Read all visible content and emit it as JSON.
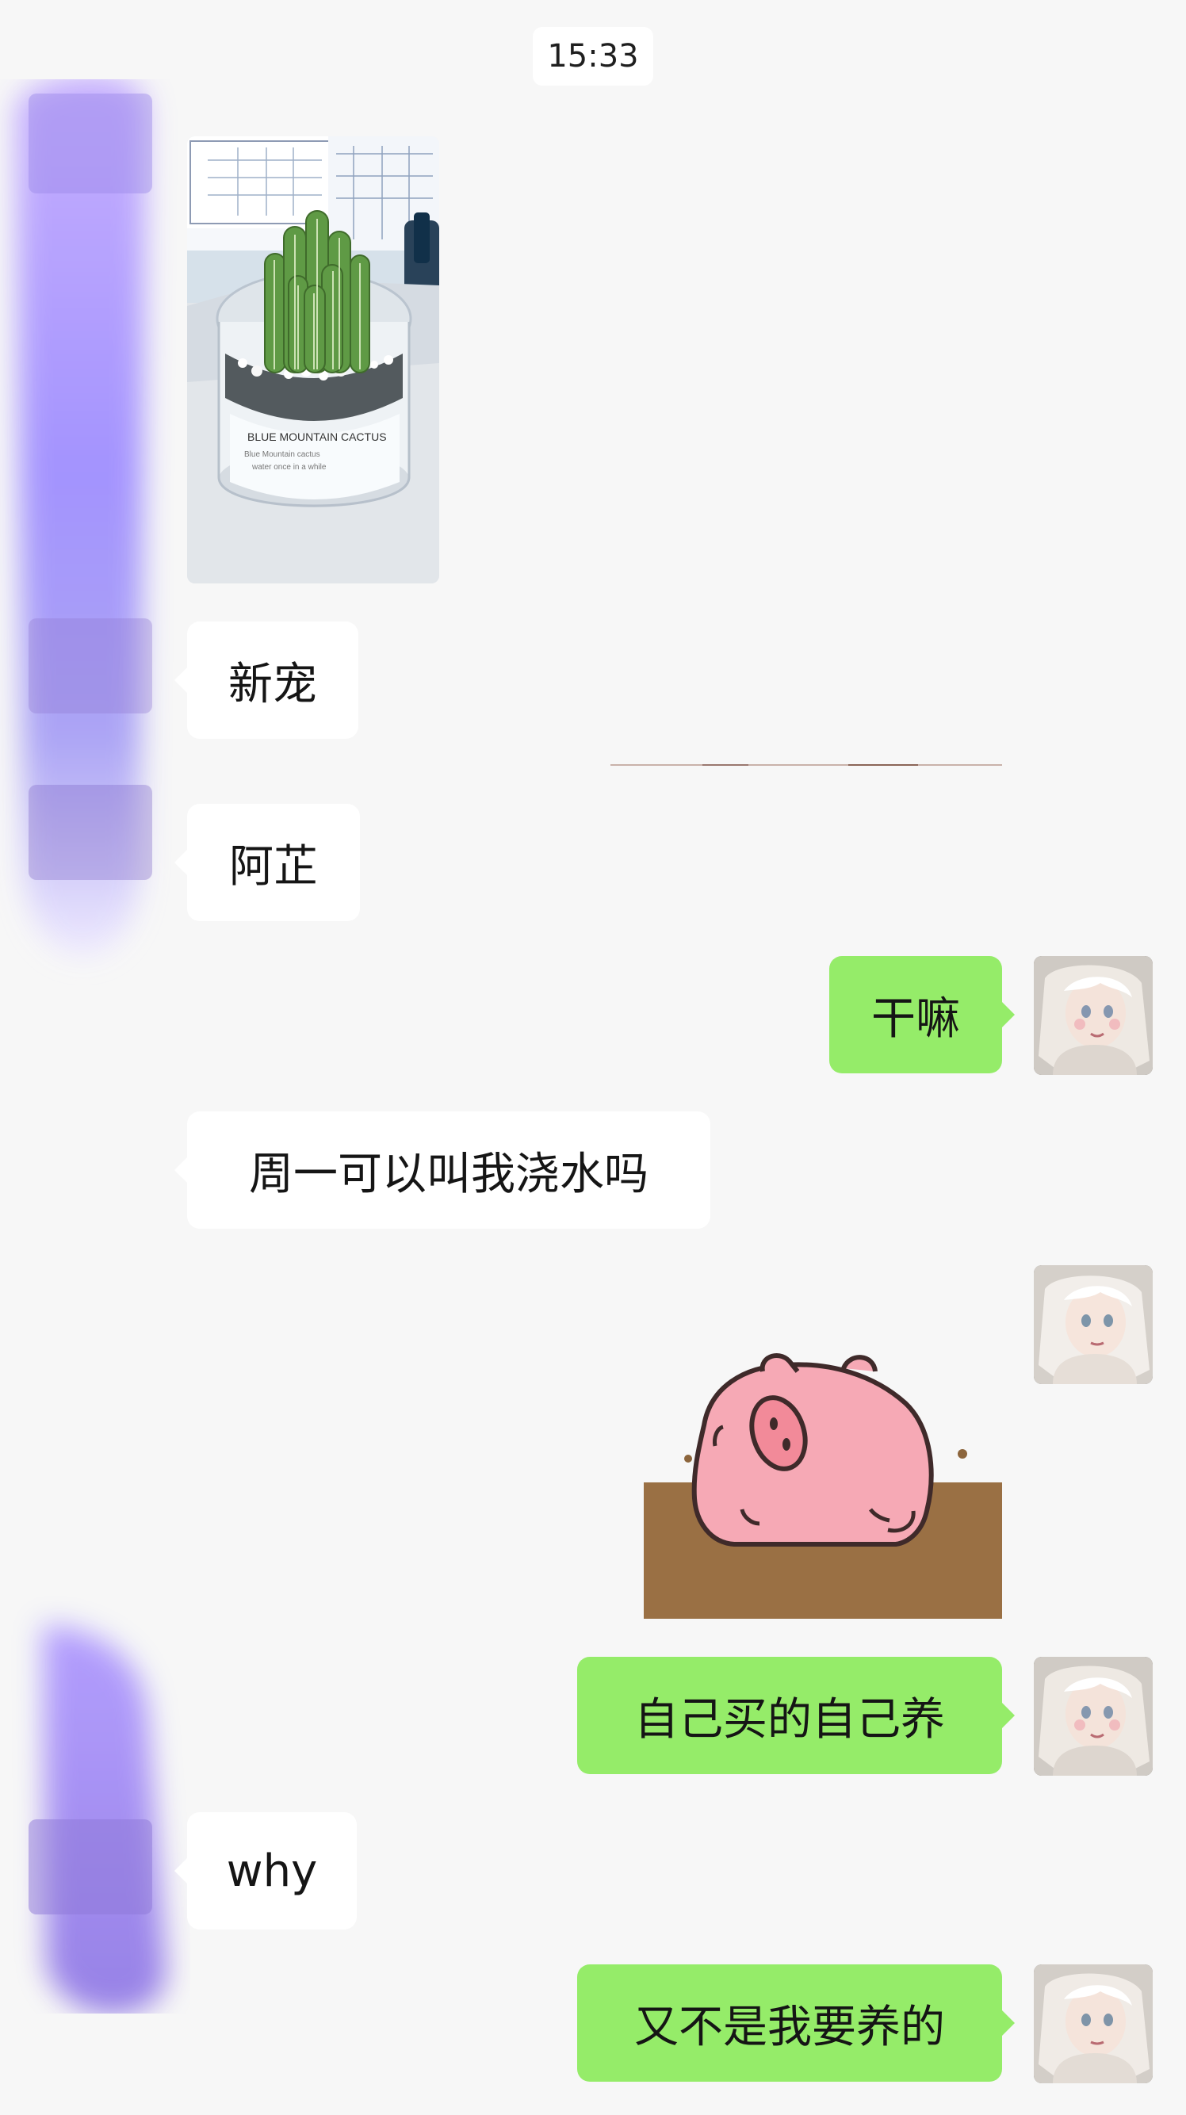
{
  "timestamp": "15:33",
  "messages": {
    "photo_caption": "新宠",
    "name_message": "阿芷",
    "reply_1": "干嘛",
    "question": "周一可以叫我浇水吗",
    "reply_2": "自己买的自己养",
    "why": "why",
    "reply_3": "又不是我要养的"
  },
  "photo_texts": {
    "label_line_1": "BLUE MOUNTAIN CACTUS",
    "label_line_2": "Blue Mountain cactus",
    "label_line_3": "water once in a while"
  },
  "colors": {
    "chat_bg": "#f7f7f7",
    "incoming_bubble": "#ffffff",
    "outgoing_bubble": "#95ec69",
    "text": "#151515",
    "sticker_pig": "#f5a8b4",
    "sticker_soil": "#9a7044"
  },
  "icons": {
    "incoming_avatar": "blurred-avatar-icon",
    "outgoing_avatar": "girl-avatar-icon",
    "photo": "cactus-photo-icon",
    "sticker": "pig-sticker-icon"
  }
}
